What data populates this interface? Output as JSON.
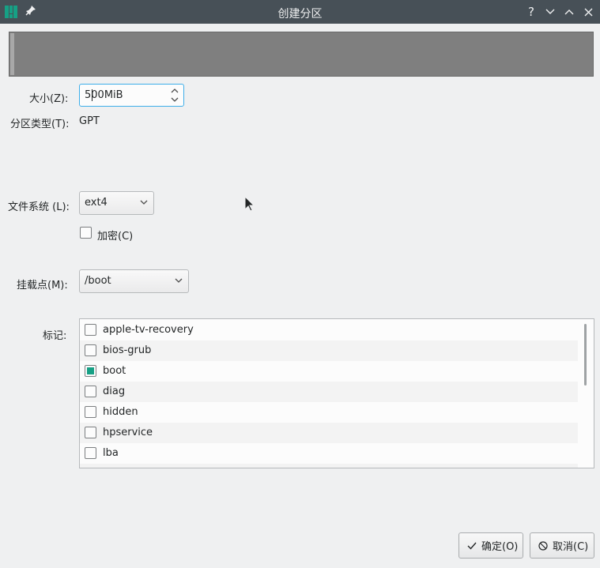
{
  "window": {
    "title": "创建分区",
    "help_glyph": "?",
    "icons": [
      "manjaro-logo-icon",
      "pin-icon",
      "help-icon",
      "minimize-icon",
      "maximize-icon",
      "close-icon"
    ]
  },
  "partition_bar": {
    "fill_fraction": 1.0
  },
  "size": {
    "label": "大小(Z):",
    "value": "500MiB"
  },
  "partition_type": {
    "label": "分区类型(T):",
    "value": "GPT"
  },
  "filesystem": {
    "label": "文件系统 (L):",
    "value": "ext4",
    "encrypt_label": "加密(C)",
    "encrypt_checked": false
  },
  "mount_point": {
    "label": "挂载点(M):",
    "value": "/boot"
  },
  "flags": {
    "label": "标记:",
    "items": [
      {
        "label": "apple-tv-recovery",
        "checked": false
      },
      {
        "label": "bios-grub",
        "checked": false
      },
      {
        "label": "boot",
        "checked": true
      },
      {
        "label": "diag",
        "checked": false
      },
      {
        "label": "hidden",
        "checked": false
      },
      {
        "label": "hpservice",
        "checked": false
      },
      {
        "label": "lba",
        "checked": false
      }
    ]
  },
  "buttons": {
    "ok": "确定(O)",
    "cancel": "取消(C)"
  },
  "colors": {
    "titlebar": "#475057",
    "accent": "#16a085",
    "focus": "#3daee9",
    "background": "#eff0f1"
  }
}
